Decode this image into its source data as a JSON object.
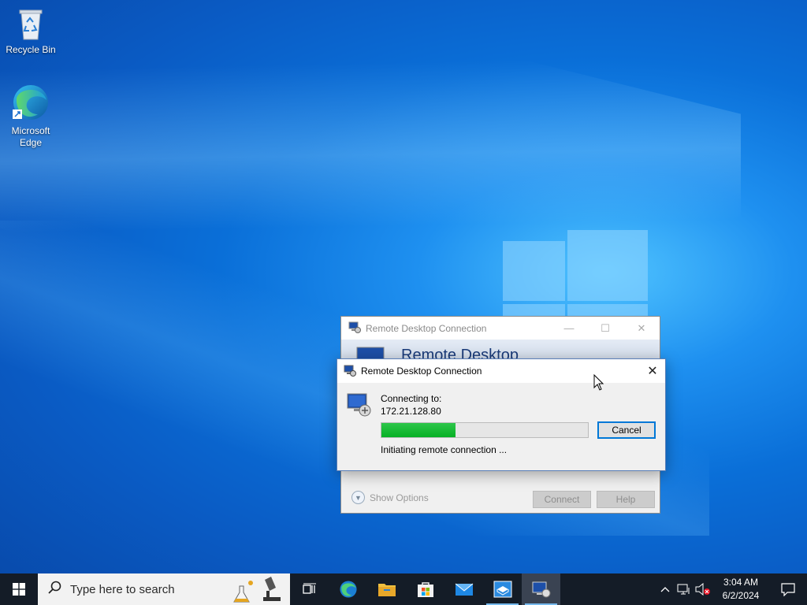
{
  "desktop": {
    "icons": [
      {
        "label": "Recycle Bin",
        "icon": "recycle-bin-icon"
      },
      {
        "label": "Microsoft Edge",
        "icon": "edge-icon"
      }
    ]
  },
  "main_window": {
    "title": "Remote Desktop Connection",
    "banner_text": "Remote Desktop",
    "show_options_label": "Show Options",
    "connect_label": "Connect",
    "help_label": "Help"
  },
  "dialog": {
    "title": "Remote Desktop Connection",
    "connecting_label": "Connecting to:",
    "host": "172.21.128.80",
    "progress": 0.36,
    "cancel_label": "Cancel",
    "status_text": "Initiating remote connection ..."
  },
  "taskbar": {
    "search_placeholder": "Type here to search",
    "apps": [
      "task-view-icon",
      "edge-icon",
      "file-explorer-icon",
      "microsoft-store-icon",
      "mail-icon",
      "sandbox-icon",
      "remote-desktop-icon"
    ],
    "clock_time": "3:04 AM",
    "clock_date": "6/2/2024"
  },
  "colors": {
    "progress_fill": "#06b025",
    "accent": "#0078d7",
    "taskbar_bg": "#141c27"
  }
}
